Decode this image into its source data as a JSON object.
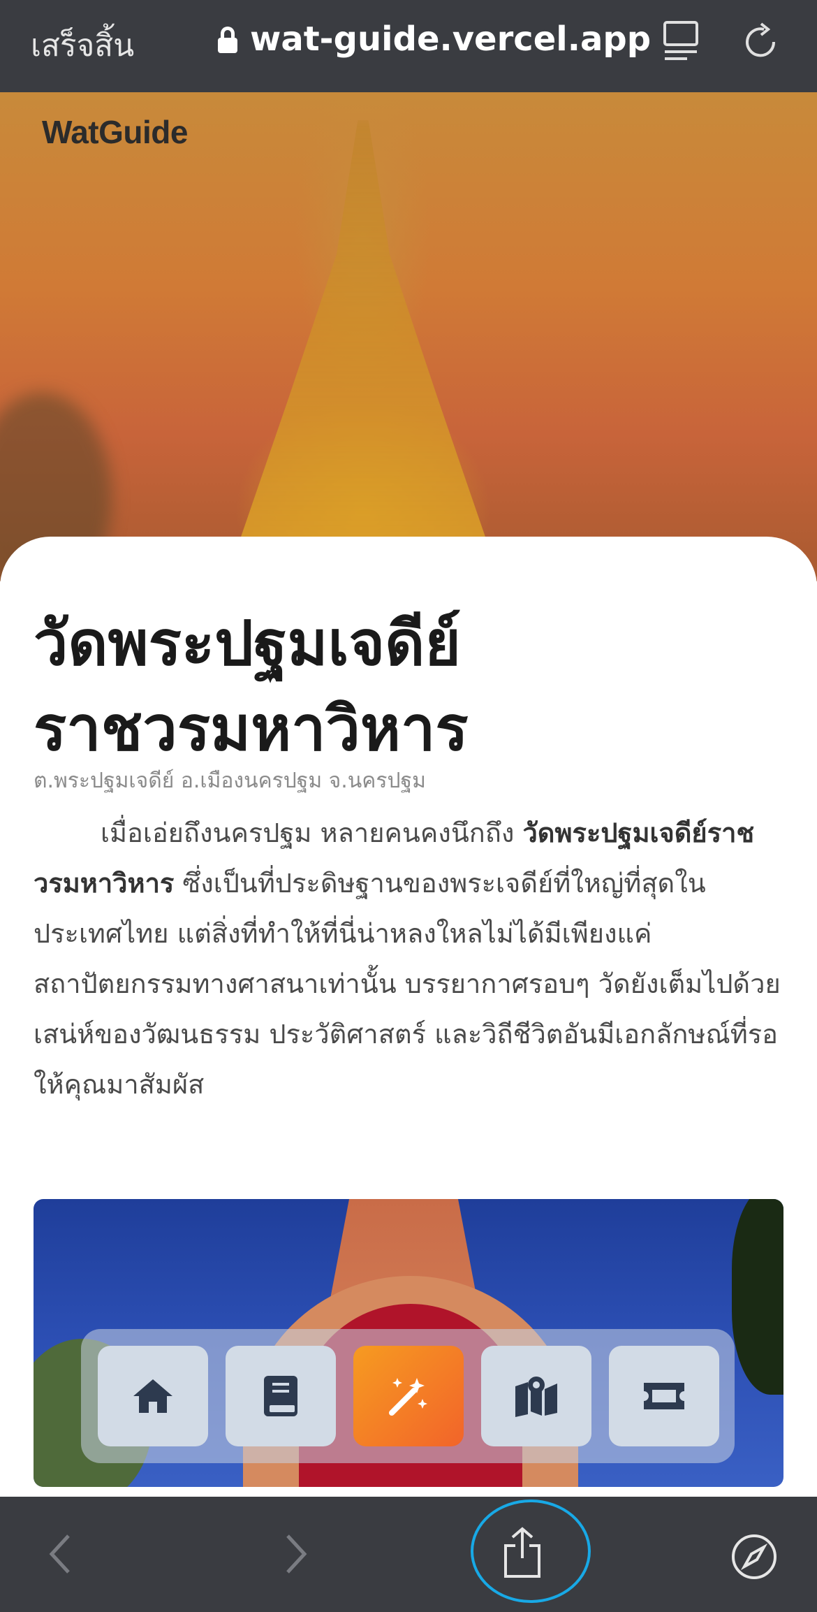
{
  "browser": {
    "done_label": "เสร็จสิ้น",
    "url": "wat-guide.vercel.app"
  },
  "hero": {
    "logo": "WatGuide"
  },
  "article": {
    "title_line1": "วัดพระปฐมเจดีย์",
    "title_line2": "ราชวรมหาวิหาร",
    "location": "ต.พระปฐมเจดีย์ อ.เมืองนครปฐม จ.นครปฐม",
    "intro_lead": "เมื่อเอ่ยถึงนครปฐม หลายคนคงนึกถึง ",
    "intro_bold": "วัดพระปฐมเจดีย์ราชวรมหาวิหาร",
    "intro_rest": " ซึ่งเป็นที่ประดิษฐานของพระเจดีย์ที่ใหญ่ที่สุดในประเทศไทย แต่สิ่งที่ทำให้ที่นี่น่าหลงใหลไม่ได้มีเพียงแค่สถาปัตยกรรมทางศาสนาเท่านั้น บรรยากาศรอบๆ วัดยังเต็มไปด้วยเสน่ห์ของวัฒนธรรม ประวัติศาสตร์ และวิถีชีวิตอันมีเอกลักษณ์ที่รอให้คุณมาสัมผัส"
  },
  "nav": {
    "items": [
      "home-icon",
      "book-icon",
      "magic-wand-icon",
      "map-icon",
      "ticket-icon"
    ],
    "active_index": 2
  },
  "colors": {
    "bar_bg": "#3a3c41",
    "active_nav": "#f47e26",
    "nav_btn": "#d2dbe6",
    "icon_dark": "#2d3a4f",
    "highlight": "#18a9e6"
  }
}
